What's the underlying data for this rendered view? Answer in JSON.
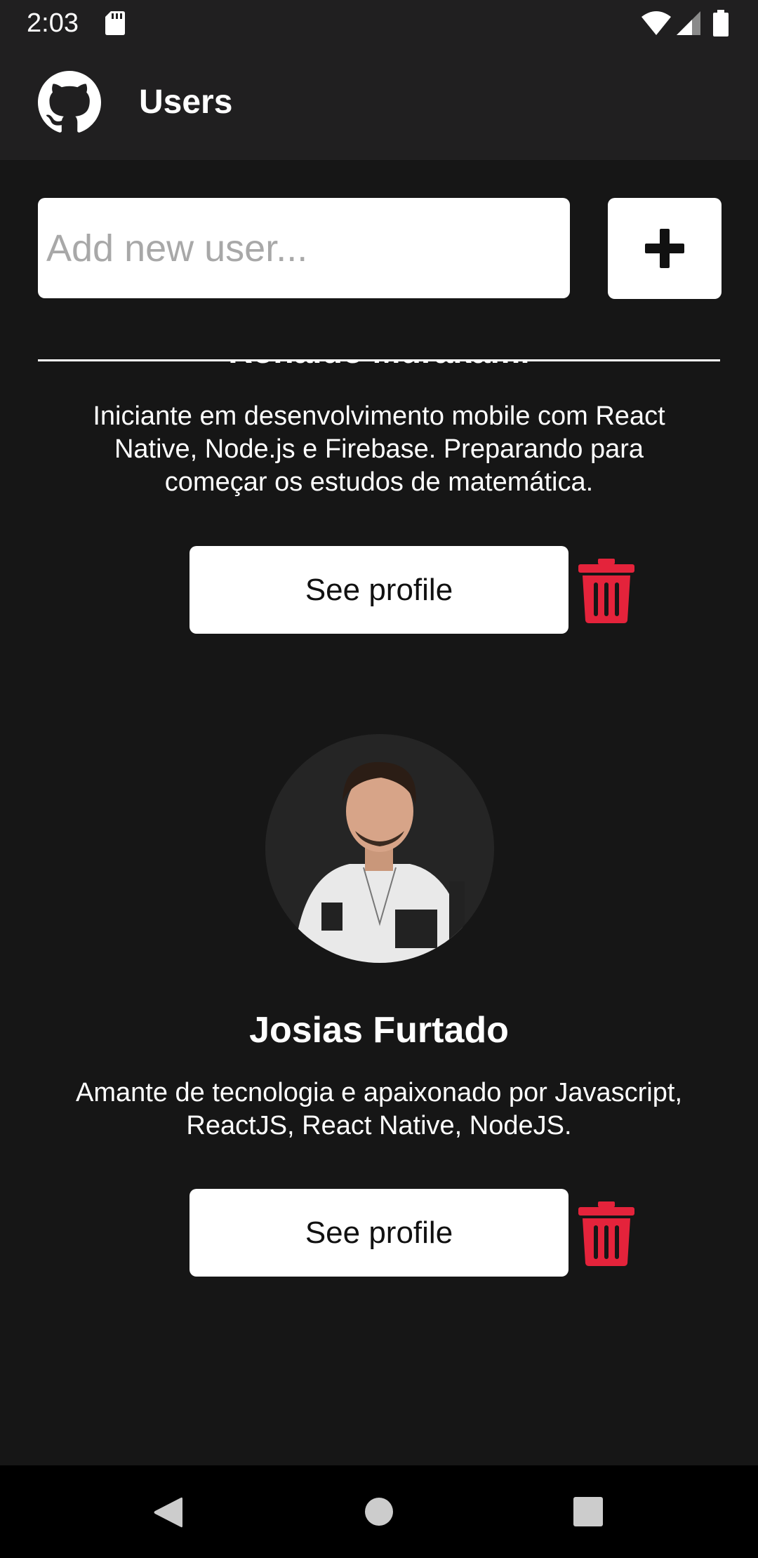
{
  "status_bar": {
    "time": "2:03",
    "icons": [
      "sd-card-icon",
      "wifi-icon",
      "cell-signal-icon",
      "battery-icon"
    ]
  },
  "app_bar": {
    "title": "Users",
    "logo_icon": "github-icon"
  },
  "new_user": {
    "placeholder": "Add new user...",
    "value": "",
    "add_icon": "plus-icon"
  },
  "users": [
    {
      "name": "Ronaldo Murakami",
      "bio": "Iniciante em desenvolvimento mobile com React Native, Node.js e Firebase. Preparando para começar os estudos de matemática.",
      "see_profile_label": "See profile",
      "delete_icon": "trash-icon"
    },
    {
      "name": "Josias Furtado",
      "bio": "Amante de tecnologia e apaixonado por Javascript, ReactJS, React Native, NodeJS.",
      "see_profile_label": "See profile",
      "delete_icon": "trash-icon"
    }
  ],
  "colors": {
    "background": "#161616",
    "app_bar": "#201f20",
    "delete_accent": "#e4233b",
    "button_bg": "#ffffff"
  },
  "nav_bar": {
    "icons": [
      "back-icon",
      "home-icon",
      "recent-apps-icon"
    ]
  }
}
